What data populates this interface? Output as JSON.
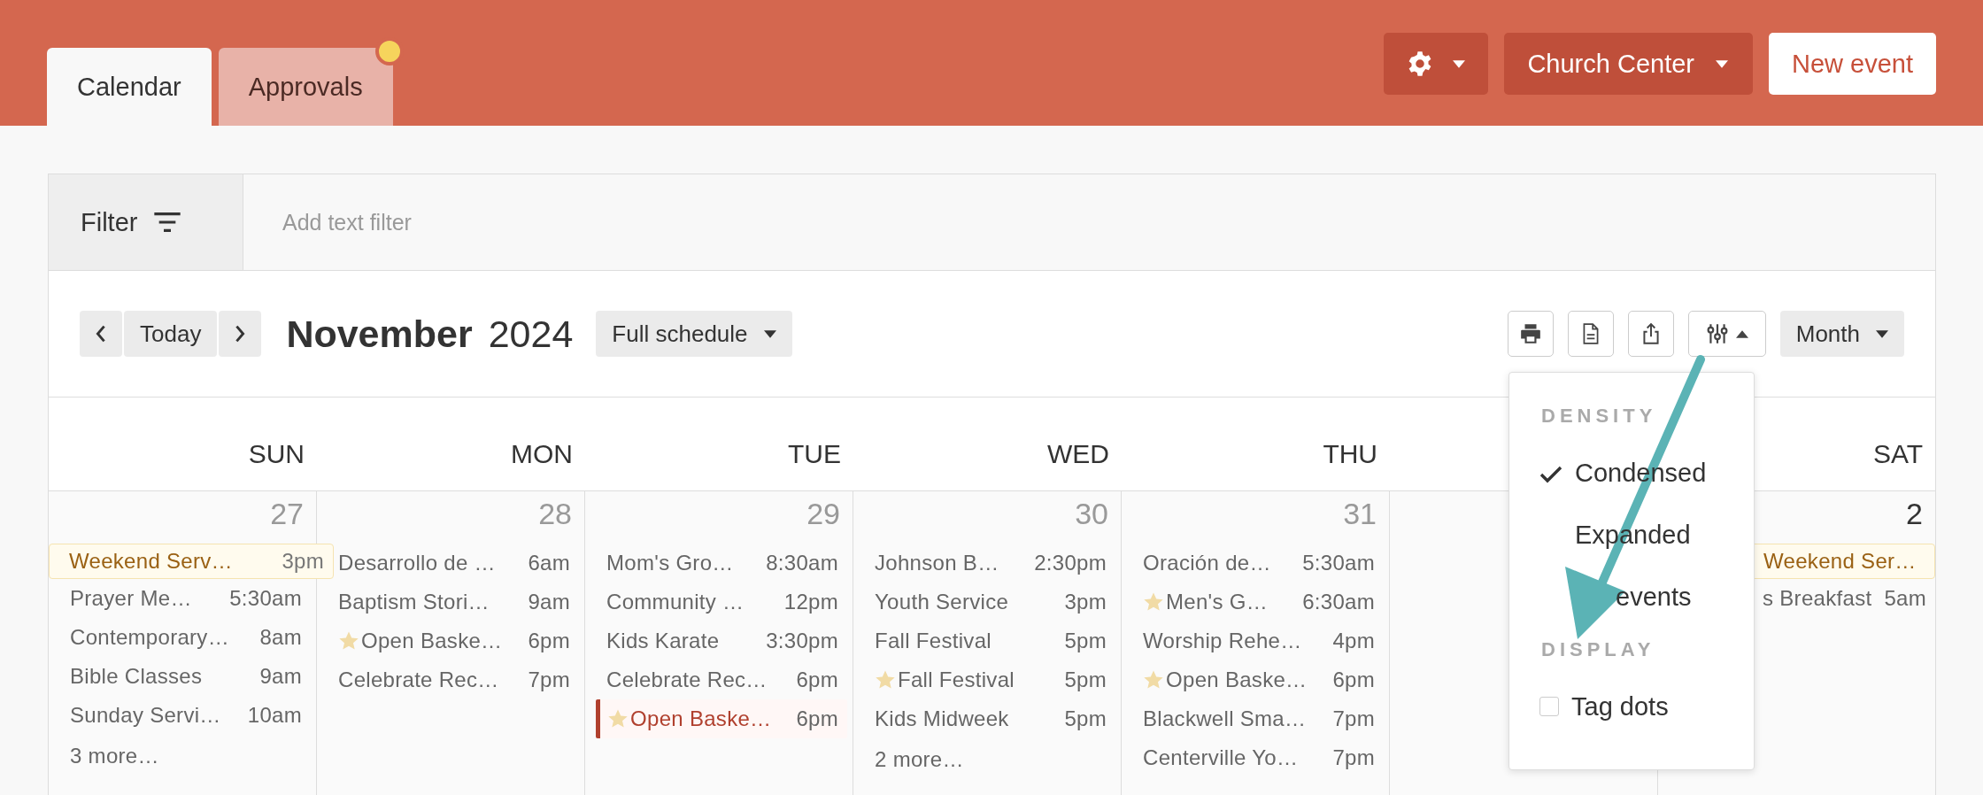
{
  "tabs": [
    {
      "label": "Calendar",
      "selected": true,
      "badge": false
    },
    {
      "label": "Approvals",
      "selected": false,
      "badge": true
    }
  ],
  "header_buttons": {
    "organization": "Church Center",
    "new_event": "New event"
  },
  "filter": {
    "label": "Filter",
    "placeholder": "Add text filter"
  },
  "toolbar": {
    "today": "Today",
    "month": "November",
    "year": "2024",
    "schedule": "Full schedule",
    "view": "Month"
  },
  "days": [
    {
      "day": "SUN",
      "date": "27",
      "in_month": false,
      "events": [
        {
          "title": "Weekend Serv…",
          "time": "3pm",
          "kind": "featured",
          "starred": false
        },
        {
          "title": "Prayer Me…",
          "time": "5:30am",
          "kind": "plain",
          "starred": false
        },
        {
          "title": "Contemporary…",
          "time": "8am",
          "kind": "plain",
          "starred": false
        },
        {
          "title": "Bible Classes",
          "time": "9am",
          "kind": "plain",
          "starred": false
        },
        {
          "title": "Sunday Servi…",
          "time": "10am",
          "kind": "plain",
          "starred": false
        }
      ],
      "more": "3 more…"
    },
    {
      "day": "MON",
      "date": "28",
      "in_month": false,
      "events": [
        {
          "title": "Desarrollo de …",
          "time": "6am",
          "kind": "plain",
          "starred": false
        },
        {
          "title": "Baptism Stori…",
          "time": "9am",
          "kind": "plain",
          "starred": false
        },
        {
          "title": "Open Baske…",
          "time": "6pm",
          "kind": "plain",
          "starred": true
        },
        {
          "title": "Celebrate Rec…",
          "time": "7pm",
          "kind": "plain",
          "starred": false
        }
      ]
    },
    {
      "day": "TUE",
      "date": "29",
      "in_month": false,
      "events": [
        {
          "title": "Mom's Gro…",
          "time": "8:30am",
          "kind": "plain",
          "starred": false
        },
        {
          "title": "Community …",
          "time": "12pm",
          "kind": "plain",
          "starred": false
        },
        {
          "title": "Kids Karate",
          "time": "3:30pm",
          "kind": "plain",
          "starred": false
        },
        {
          "title": "Celebrate Rec…",
          "time": "6pm",
          "kind": "plain",
          "starred": false
        },
        {
          "title": "Open Baske…",
          "time": "6pm",
          "kind": "flagged",
          "starred": true
        }
      ]
    },
    {
      "day": "WED",
      "date": "30",
      "in_month": false,
      "events": [
        {
          "title": "Johnson B…",
          "time": "2:30pm",
          "kind": "plain",
          "starred": false
        },
        {
          "title": "Youth Service",
          "time": "3pm",
          "kind": "plain",
          "starred": false
        },
        {
          "title": "Fall Festival",
          "time": "5pm",
          "kind": "plain",
          "starred": false
        },
        {
          "title": "Fall Festival",
          "time": "5pm",
          "kind": "plain",
          "starred": true
        },
        {
          "title": "Kids Midweek",
          "time": "5pm",
          "kind": "plain",
          "starred": false
        }
      ],
      "more": "2 more…"
    },
    {
      "day": "THU",
      "date": "31",
      "in_month": false,
      "events": [
        {
          "title": "Oración de…",
          "time": "5:30am",
          "kind": "plain",
          "starred": false
        },
        {
          "title": "Men's G…",
          "time": "6:30am",
          "kind": "plain",
          "starred": true
        },
        {
          "title": "Worship Rehe…",
          "time": "4pm",
          "kind": "plain",
          "starred": false
        },
        {
          "title": "Open Baske…",
          "time": "6pm",
          "kind": "plain",
          "starred": true
        },
        {
          "title": "Blackwell Sma…",
          "time": "7pm",
          "kind": "plain",
          "starred": false
        },
        {
          "title": "Centerville Yo…",
          "time": "7pm",
          "kind": "plain",
          "starred": false
        }
      ]
    },
    {
      "covered": true
    },
    {
      "day": "SAT",
      "date": "2",
      "in_month": true,
      "covered": true,
      "events": [
        {
          "title": "Weekend Ser…",
          "kind": "featured",
          "starred": false
        },
        {
          "title": "s Breakfast",
          "time": "5am",
          "kind": "plain",
          "starred": false
        }
      ]
    }
  ],
  "menu": {
    "sections": [
      {
        "heading": "DENSITY",
        "items": [
          {
            "label": "Condensed",
            "kind": "radio",
            "selected": true,
            "covered": false
          },
          {
            "label": "Expanded",
            "kind": "radio",
            "selected": false,
            "covered": false
          },
          {
            "label": "events",
            "kind": "radio",
            "selected": false,
            "covered": true
          }
        ]
      },
      {
        "heading": "DISPLAY",
        "items": [
          {
            "label": "Tag dots",
            "kind": "checkbox",
            "checked": false,
            "covered": false
          }
        ]
      }
    ]
  }
}
